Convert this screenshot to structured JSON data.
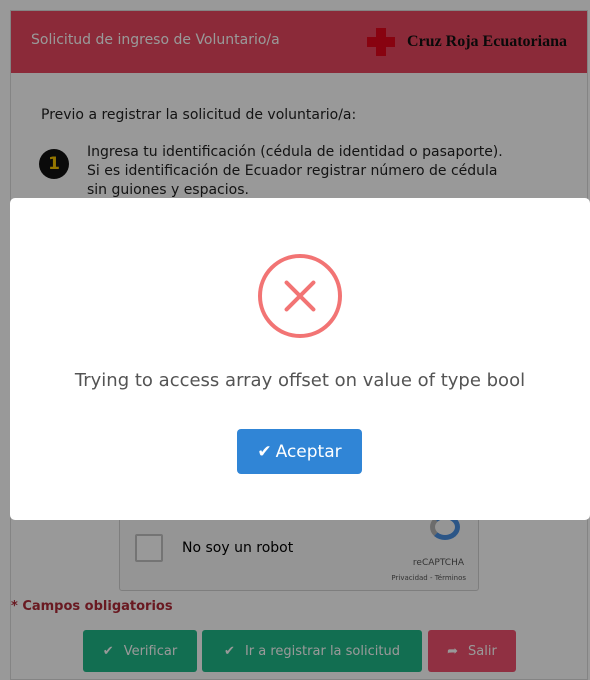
{
  "header": {
    "title": "Solicitud de ingreso de Voluntario/a",
    "brand": "Cruz Roja Ecuatoriana",
    "brand_color": "#e3051b",
    "bar_color": "#e8475f"
  },
  "form": {
    "intro": "Previo a registrar la solicitud de voluntario/a:",
    "step": {
      "number": "1",
      "lines": [
        "Ingresa tu identificación (cédula de identidad o pasaporte).",
        "Si es identificación de Ecuador registrar número de cédula",
        "sin guiones y espacios."
      ]
    },
    "captcha": {
      "label": "No soy un robot",
      "brand": "reCAPTCHA",
      "links": "Privacidad - Términos"
    },
    "required_note": "* Campos obligatorios",
    "buttons": {
      "verify": "Verificar",
      "register": "Ir a registrar la solicitud",
      "exit": "Salir"
    }
  },
  "modal": {
    "icon": "error-x-icon",
    "message": "Trying to access array offset on value of type bool",
    "confirm": "Aceptar",
    "confirm_color": "#3085d6",
    "icon_color": "#f27474"
  }
}
